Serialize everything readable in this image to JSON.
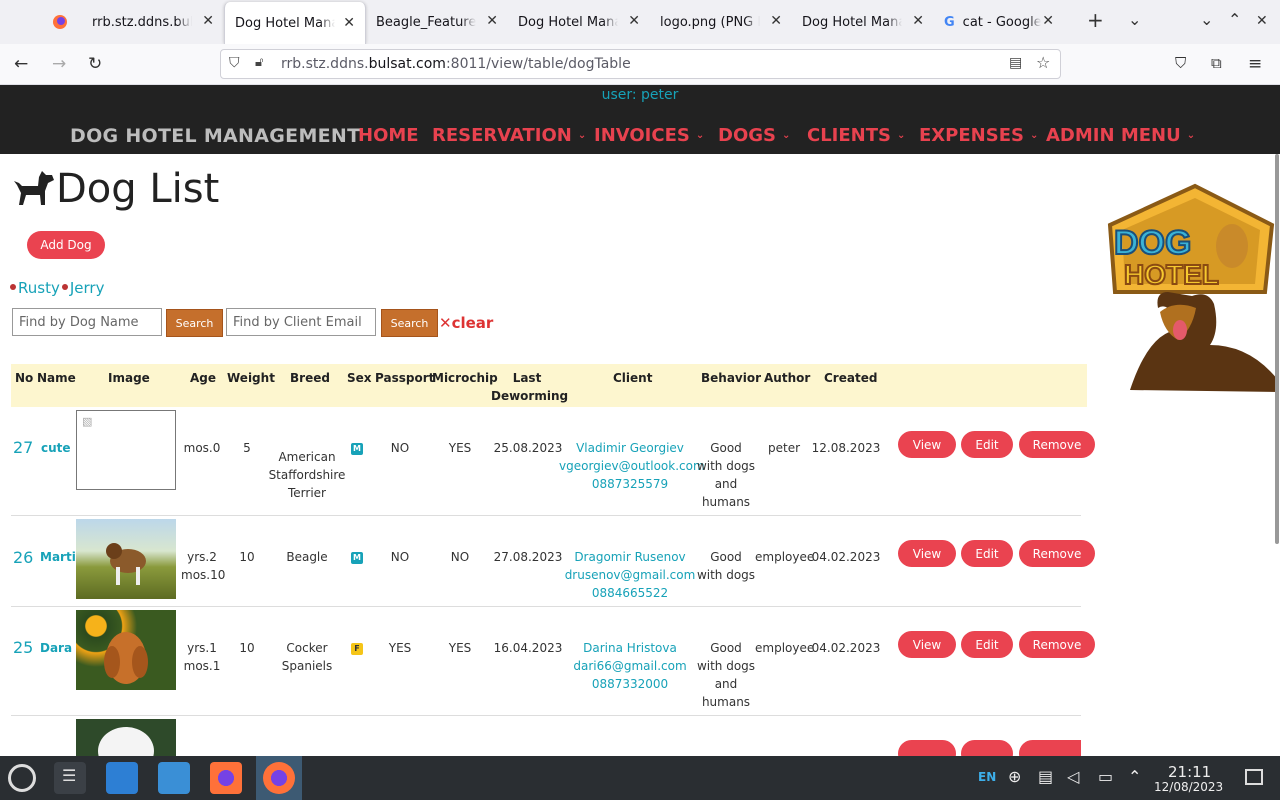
{
  "browser": {
    "tabs": [
      {
        "label": "rrb.stz.ddns.bulsat",
        "active": false
      },
      {
        "label": "Dog Hotel Manag",
        "active": true
      },
      {
        "label": "Beagle_Featured",
        "active": false
      },
      {
        "label": "Dog Hotel Manag",
        "active": false
      },
      {
        "label": "logo.png (PNG In",
        "active": false
      },
      {
        "label": "Dog Hotel Manag",
        "active": false
      },
      {
        "label": "cat - Google S",
        "active": false
      }
    ],
    "url_prefix": "rrb.stz.ddns.",
    "url_domain": "bulsat.com",
    "url_rest": ":8011/view/table/dogTable"
  },
  "site": {
    "user_line": "user: peter",
    "brand": "DOG HOTEL MANAGEMENT",
    "menu": [
      "HOME",
      "RESERVATION",
      "INVOICES",
      "DOGS",
      "CLIENTS",
      "EXPENSES",
      "ADMIN MENU"
    ],
    "page_title": "Dog List",
    "add_dog": "Add Dog",
    "quick_names": [
      "Rusty",
      "Jerry"
    ],
    "search_dog_placeholder": "Find by Dog Name",
    "search_client_placeholder": "Find by Client Email",
    "search_label": "Search",
    "clear_label": "clear",
    "logo_text_1": "DOG",
    "logo_text_2": "HOTEL"
  },
  "table": {
    "headers": [
      "No",
      "Name",
      "Image",
      "Age",
      "Weight",
      "Breed",
      "Sex",
      "Passport",
      "Microchip",
      "Last Deworming",
      "Client",
      "Behavior",
      "Author",
      "Created"
    ],
    "actions": [
      "View",
      "Edit",
      "Remove"
    ],
    "rows": [
      {
        "no": "27",
        "name": "cute",
        "age": [
          "mos.0"
        ],
        "weight": "5",
        "breed": [
          "American",
          "Staffordshire",
          "Terrier"
        ],
        "sex": "M",
        "passport": "NO",
        "microchip": "YES",
        "deworming": "25.08.2023",
        "client": [
          "Vladimir Georgiev",
          "vgeorgiev@outlook.com",
          "0887325579"
        ],
        "behavior": [
          "Good",
          "with dogs",
          "and",
          "humans"
        ],
        "author": "peter",
        "created": "12.08.2023"
      },
      {
        "no": "26",
        "name": "Marti",
        "age": [
          "yrs.2",
          "mos.10"
        ],
        "weight": "10",
        "breed": [
          "Beagle"
        ],
        "sex": "M",
        "passport": "NO",
        "microchip": "NO",
        "deworming": "27.08.2023",
        "client": [
          "Dragomir Rusenov",
          "drusenov@gmail.com",
          "0884665522"
        ],
        "behavior": [
          "Good",
          "with dogs"
        ],
        "author": "employee",
        "created": "04.02.2023"
      },
      {
        "no": "25",
        "name": "Dara",
        "age": [
          "yrs.1",
          "mos.1"
        ],
        "weight": "10",
        "breed": [
          "Cocker",
          "Spaniels"
        ],
        "sex": "F",
        "passport": "YES",
        "microchip": "YES",
        "deworming": "16.04.2023",
        "client": [
          "Darina Hristova",
          "dari66@gmail.com",
          "0887332000"
        ],
        "behavior": [
          "Good",
          "with dogs",
          "and",
          "humans"
        ],
        "author": "employee",
        "created": "04.02.2023"
      }
    ]
  },
  "taskbar": {
    "lang": "EN",
    "time": "21:11",
    "date": "12/08/2023"
  },
  "colors": {
    "accent_red": "#ea4350",
    "link": "#17a2b8",
    "search_btn": "#c56f2c",
    "header_bg": "#fdf6cf",
    "nav_dark": "#222222"
  }
}
